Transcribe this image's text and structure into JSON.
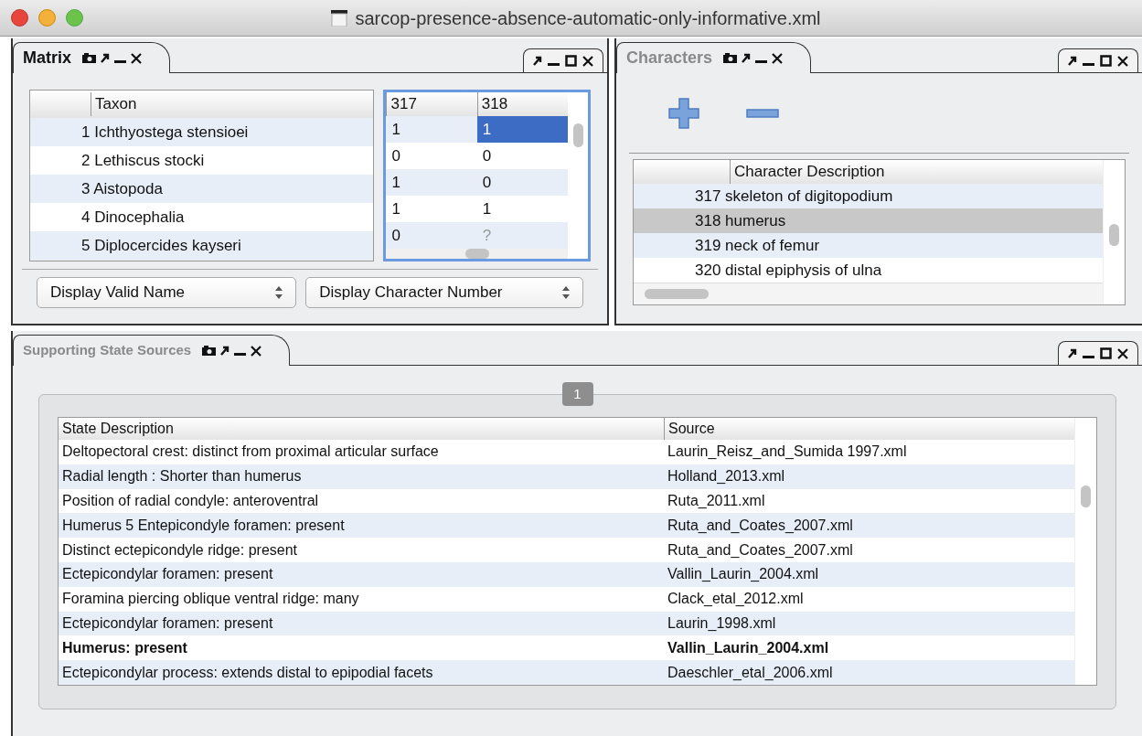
{
  "window": {
    "title": "sarcop-presence-absence-automatic-only-informative.xml"
  },
  "matrix": {
    "tab": {
      "label": "Matrix",
      "active": true
    },
    "taxon_column": "Taxon",
    "character_columns": [
      "317",
      "318"
    ],
    "rows": [
      {
        "taxon": "1 Ichthyostega stensioei",
        "cells": [
          {
            "value": "1",
            "selected": false,
            "missing": false
          },
          {
            "value": "1",
            "selected": true,
            "missing": false
          }
        ]
      },
      {
        "taxon": "2 Lethiscus stocki",
        "cells": [
          {
            "value": "0",
            "selected": false,
            "missing": false
          },
          {
            "value": "0",
            "selected": false,
            "missing": false
          }
        ]
      },
      {
        "taxon": "3 Aistopoda",
        "cells": [
          {
            "value": "1",
            "selected": false,
            "missing": false
          },
          {
            "value": "0",
            "selected": false,
            "missing": false
          }
        ]
      },
      {
        "taxon": "4 Dinocephalia",
        "cells": [
          {
            "value": "1",
            "selected": false,
            "missing": false
          },
          {
            "value": "1",
            "selected": false,
            "missing": false
          }
        ]
      },
      {
        "taxon": "5 Diplocercides kayseri",
        "cells": [
          {
            "value": "0",
            "selected": false,
            "missing": false
          },
          {
            "value": "?",
            "selected": false,
            "missing": true
          }
        ]
      }
    ],
    "dropdowns": [
      "Display Valid Name",
      "Display Character Number"
    ]
  },
  "characters": {
    "tab": {
      "label": "Characters",
      "active": false
    },
    "column": "Character Description",
    "rows": [
      {
        "text": "317 skeleton of digitopodium",
        "selected": false
      },
      {
        "text": "318 humerus",
        "selected": true
      },
      {
        "text": "319 neck of femur",
        "selected": false
      },
      {
        "text": "320 distal epiphysis of ulna",
        "selected": false
      }
    ]
  },
  "sources": {
    "tab": {
      "label": "Supporting State Sources",
      "active": false
    },
    "page": "1",
    "columns": [
      "State Description",
      "Source"
    ],
    "rows": [
      {
        "description": "Deltopectoral crest: distinct from proximal articular surface",
        "source": "Laurin_Reisz_and_Sumida 1997.xml",
        "emphasized": false
      },
      {
        "description": "Radial length : Shorter than humerus",
        "source": "Holland_2013.xml",
        "emphasized": false
      },
      {
        "description": "Position of radial condyle: anteroventral",
        "source": "Ruta_2011.xml",
        "emphasized": false
      },
      {
        "description": "Humerus 5 Entepicondyle foramen: present",
        "source": "Ruta_and_Coates_2007.xml",
        "emphasized": false
      },
      {
        "description": "Distinct ectepicondyle ridge: present",
        "source": "Ruta_and_Coates_2007.xml",
        "emphasized": false
      },
      {
        "description": "Ectepicondylar foramen: present",
        "source": "Vallin_Laurin_2004.xml",
        "emphasized": false
      },
      {
        "description": "Foramina piercing oblique ventral ridge: many",
        "source": "Clack_etal_2012.xml",
        "emphasized": false
      },
      {
        "description": "Ectepicondylar foramen: present",
        "source": "Laurin_1998.xml",
        "emphasized": false
      },
      {
        "description": "Humerus: present",
        "source": "Vallin_Laurin_2004.xml",
        "emphasized": true
      },
      {
        "description": "Ectepicondylar process: extends distal to epipodial facets",
        "source": "Daeschler_etal_2006.xml",
        "emphasized": false
      }
    ]
  }
}
